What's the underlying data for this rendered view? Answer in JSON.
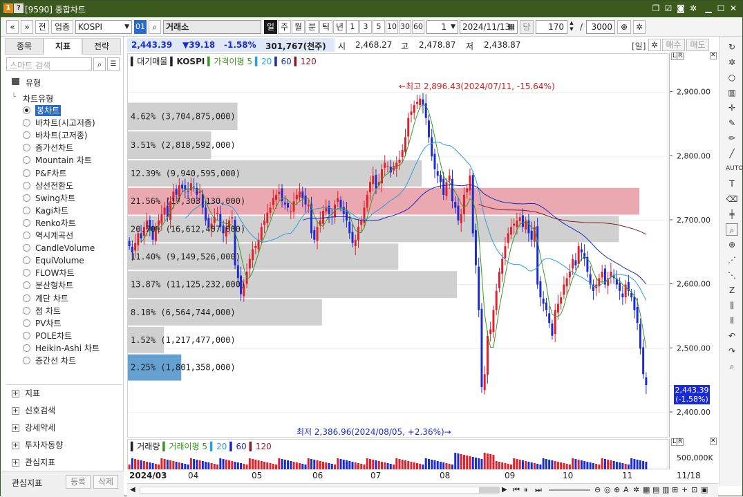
{
  "window": {
    "badge1": "1",
    "badge2": "?",
    "title": "[9590] 종합차트"
  },
  "toolbar": {
    "prev": "«",
    "next": "»",
    "prev_btn": "전",
    "sector_btn": "업종",
    "symbol_value": "KOSPI",
    "code_badge": "01",
    "search_icon": "⌕",
    "symbol_name": "거래소",
    "periods": [
      "일",
      "주",
      "월",
      "분",
      "틱",
      "년"
    ],
    "intervals": [
      "1",
      "3",
      "5",
      "10",
      "30",
      "60"
    ],
    "count_value": "1",
    "date_value": "2024/11/13",
    "unit_label": "당",
    "bars_value": "170",
    "slash": "/",
    "total_value": "3000"
  },
  "left": {
    "tabs": [
      "종목",
      "지표",
      "전략"
    ],
    "search_placeholder": "스마트 검색",
    "group_title": "유형",
    "tree_root": "차트유형",
    "chart_types": [
      "봉차트",
      "바차트(시고저종)",
      "바차트(고저종)",
      "종가선차트",
      "Mountain 차트",
      "P&F차트",
      "삼선전환도",
      "Swing차트",
      "Kagi차트",
      "Renko차트",
      "역시계곡선",
      "CandleVolume",
      "EquiVolume",
      "FLOW차트",
      "분산형차트",
      "계단 차트",
      "점 차트",
      "PV차트",
      "POLE차트",
      "Heikin-Ashi 차트",
      "증간선 차트"
    ],
    "selected_index": 0,
    "sections": [
      "지표",
      "신호검색",
      "강세약세",
      "투자자동향",
      "관심지표"
    ],
    "footer_label": "관심지표",
    "footer_btn1": "등록",
    "footer_btn2": "삭제"
  },
  "info": {
    "price": "2,443.39",
    "change": "▼39.18",
    "pct": "-1.58%",
    "volume": "301,767(천주)",
    "open_label": "시",
    "open": "2,468.27",
    "high_label": "고",
    "high": "2,478.87",
    "low_label": "저",
    "low": "2,438.87",
    "mode": "[일]",
    "buy": "매수",
    "sell": "매도"
  },
  "legend": {
    "main": "대기매물",
    "symbol": "KOSPI",
    "ma_label": "가격이평",
    "ma": [
      "5",
      "20",
      "60",
      "120"
    ]
  },
  "vol_legend": {
    "main": "거래량",
    "ma_label": "거래이평",
    "ma": [
      "5",
      "20",
      "60",
      "120"
    ]
  },
  "annotations": {
    "high": "최고 2,896.43(2024/07/11, -15.64%)",
    "low": "최저 2,386.96(2024/08/05, +2.36%)"
  },
  "colors": {
    "up": "#e0202a",
    "down": "#1a2bd6",
    "ma5": "#3a9a1e",
    "ma20": "#2aa0e0",
    "ma60": "#1a2bb8",
    "ma120": "#8a1a2a",
    "profile": "#c8c8c8",
    "profile_hi": "#e8a0a8",
    "profile_cur": "#4a90c8"
  },
  "chart_data": {
    "type": "candlestick",
    "ylim": [
      2360,
      2960
    ],
    "yticks": [
      "2,900.00",
      "2,800.00",
      "2,700.00",
      "2,600.00",
      "2,500.00",
      "2,400.00"
    ],
    "xticks": [
      "2024/03",
      "04",
      "05",
      "06",
      "07",
      "08",
      "09",
      "10",
      "11"
    ],
    "volume_tick": "500,000K",
    "last_date_label": "11/18",
    "last_price_label": "2,443.39",
    "last_pct_label": "(-1.58%)",
    "volume_profile": [
      {
        "label": "4.62% (3,704,875,000)",
        "pct": 4.62,
        "lo": 2840,
        "hi": 2885
      },
      {
        "label": "3.51% (2,818,592,000)",
        "pct": 3.51,
        "lo": 2795,
        "hi": 2840
      },
      {
        "label": "12.39% (9,940,595,000)",
        "pct": 12.39,
        "lo": 2752,
        "hi": 2795
      },
      {
        "label": "21.56% (17,303,130,000)",
        "pct": 21.56,
        "lo": 2708,
        "hi": 2752
      },
      {
        "label": "20.70% (16,612,407,000)",
        "pct": 20.7,
        "lo": 2665,
        "hi": 2708
      },
      {
        "label": "11.40% (9,149,526,000)",
        "pct": 11.4,
        "lo": 2622,
        "hi": 2665
      },
      {
        "label": "13.87% (11,125,232,000)",
        "pct": 13.87,
        "lo": 2578,
        "hi": 2622
      },
      {
        "label": "8.18% (6,564,744,000)",
        "pct": 8.18,
        "lo": 2535,
        "hi": 2578
      },
      {
        "label": "1.52% (1,217,477,000)",
        "pct": 1.52,
        "lo": 2492,
        "hi": 2535
      },
      {
        "label": "2.25% (1,801,358,000)",
        "pct": 2.25,
        "lo": 2449,
        "hi": 2492
      }
    ],
    "closes": [
      2660,
      2650,
      2665,
      2680,
      2672,
      2690,
      2700,
      2685,
      2670,
      2690,
      2700,
      2710,
      2720,
      2705,
      2730,
      2745,
      2740,
      2755,
      2750,
      2748,
      2745,
      2758,
      2752,
      2740,
      2745,
      2720,
      2700,
      2690,
      2695,
      2705,
      2712,
      2690,
      2680,
      2690,
      2700,
      2705,
      2630,
      2610,
      2585,
      2600,
      2620,
      2640,
      2655,
      2660,
      2670,
      2690,
      2700,
      2712,
      2720,
      2735,
      2740,
      2745,
      2730,
      2725,
      2720,
      2715,
      2730,
      2740,
      2745,
      2735,
      2725,
      2725,
      2680,
      2670,
      2690,
      2700,
      2715,
      2720,
      2710,
      2705,
      2725,
      2735,
      2720,
      2710,
      2700,
      2680,
      2665,
      2670,
      2690,
      2700,
      2720,
      2740,
      2760,
      2770,
      2750,
      2760,
      2780,
      2790,
      2785,
      2775,
      2785,
      2790,
      2795,
      2810,
      2830,
      2860,
      2870,
      2880,
      2885,
      2890,
      2880,
      2860,
      2830,
      2800,
      2780,
      2770,
      2760,
      2740,
      2760,
      2770,
      2730,
      2720,
      2700,
      2710,
      2740,
      2750,
      2770,
      2680,
      2630,
      2560,
      2440,
      2460,
      2520,
      2530,
      2560,
      2590,
      2620,
      2640,
      2660,
      2680,
      2690,
      2695,
      2700,
      2705,
      2690,
      2700,
      2680,
      2670,
      2690,
      2600,
      2580,
      2570,
      2560,
      2540,
      2520,
      2560,
      2570,
      2580,
      2600,
      2610,
      2620,
      2640,
      2630,
      2660,
      2650,
      2640,
      2620,
      2600,
      2590,
      2600,
      2610,
      2620,
      2600,
      2610,
      2620,
      2610,
      2600,
      2590,
      2580,
      2600,
      2590,
      2580,
      2560,
      2540,
      2500,
      2460,
      2443
    ]
  }
}
